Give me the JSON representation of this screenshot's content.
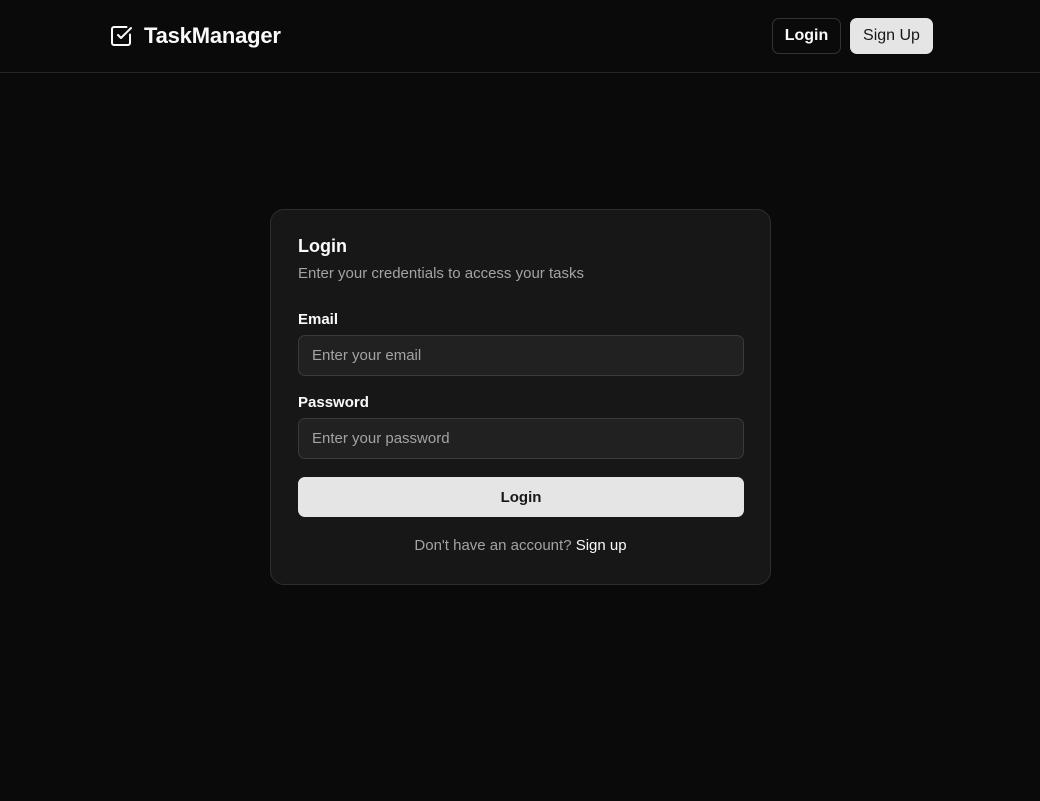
{
  "header": {
    "brand_name": "TaskManager",
    "brand_icon": "checkbox-icon",
    "login_label": "Login",
    "signup_label": "Sign Up"
  },
  "login_card": {
    "title": "Login",
    "description": "Enter your credentials to access your tasks",
    "email": {
      "label": "Email",
      "placeholder": "Enter your email",
      "value": ""
    },
    "password": {
      "label": "Password",
      "placeholder": "Enter your password",
      "value": ""
    },
    "submit_label": "Login",
    "footer_text": "Don't have an account?",
    "footer_link": "Sign up"
  },
  "colors": {
    "background": "#0a0a0a",
    "card": "#171717",
    "primary_button": "#e5e5e5",
    "muted_text": "#a3a3a3"
  }
}
